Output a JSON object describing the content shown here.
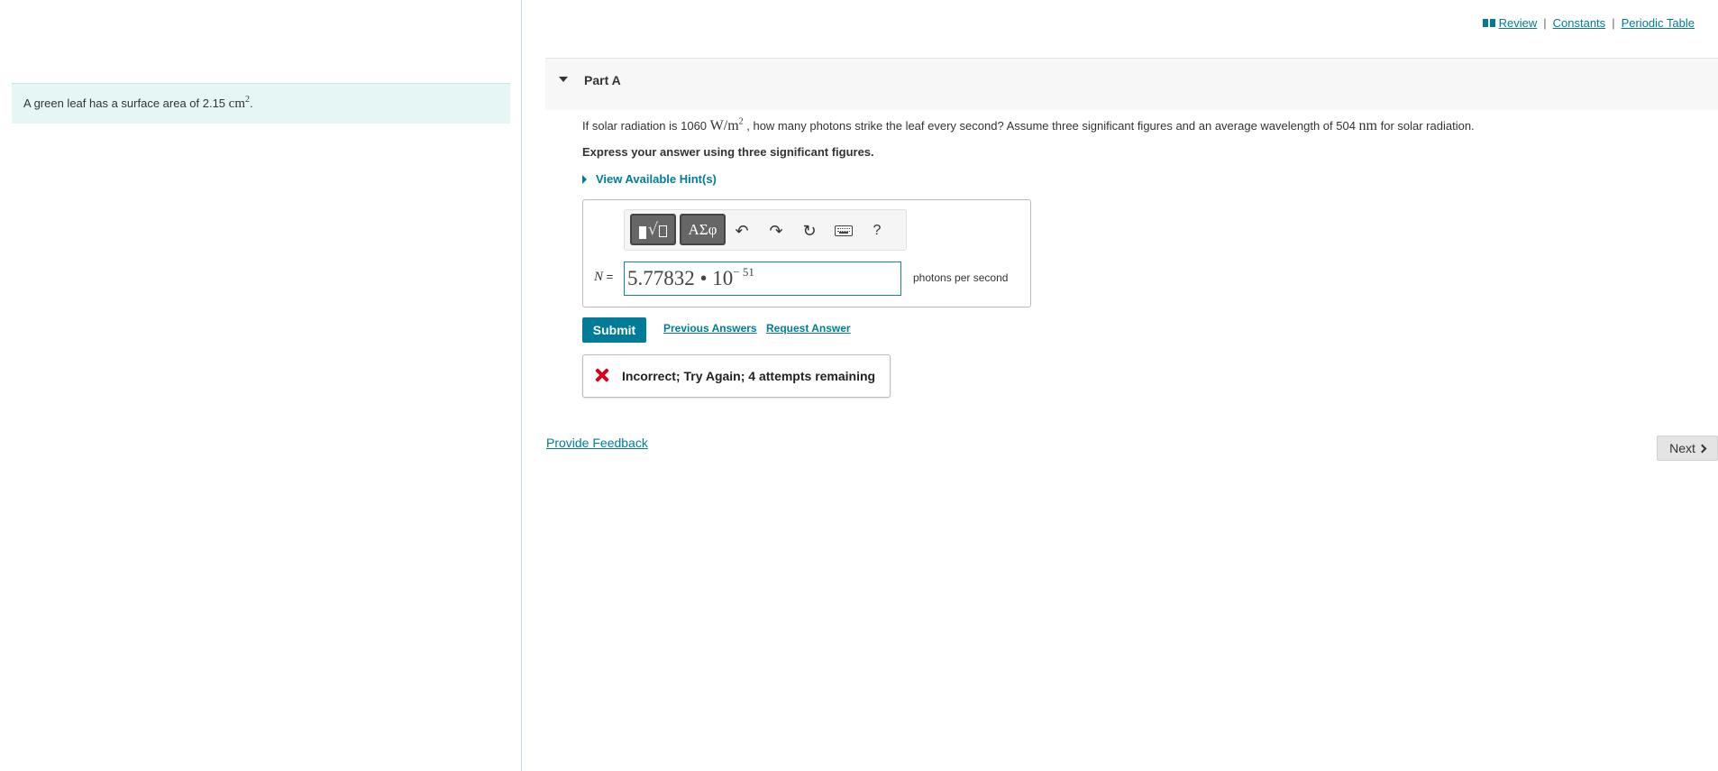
{
  "intro": {
    "text_before": "A green leaf has a surface area of 2.15 ",
    "unit": "cm",
    "unit_exp": "2",
    "text_after": "."
  },
  "top_links": {
    "review": "Review",
    "sep1": "|",
    "constants": "Constants",
    "sep2": "|",
    "periodic_table": "Periodic Table"
  },
  "part": {
    "title": "Part A"
  },
  "question": {
    "text1": "If solar radiation is 1060 ",
    "unit1": "W/m",
    "unit1_exp": "2",
    "text2": " , how many photons strike the leaf every second? Assume three significant figures and an average wavelength of 504 ",
    "unit2": "nm",
    "text3": " for solar radiation."
  },
  "instruction": "Express your answer using three significant figures.",
  "hint_toggle": "View Available Hint(s)",
  "toolbar": {
    "greek_label": "ΑΣφ",
    "undo_glyph": "↶",
    "redo_glyph": "↷",
    "reset_glyph": "↻",
    "help_label": "?"
  },
  "answer": {
    "variable": "N",
    "equals": " =",
    "mantissa": "5.77832 • 10",
    "exponent": "− 51",
    "units": "photons per second"
  },
  "actions": {
    "submit": "Submit",
    "previous_answers": "Previous Answers",
    "request_answer": "Request Answer"
  },
  "feedback": {
    "message": "Incorrect; Try Again; 4 attempts remaining"
  },
  "footer": {
    "provide_feedback": "Provide Feedback",
    "next": "Next"
  },
  "colors": {
    "accent": "#007c99",
    "intro_bg": "#e6f6f5",
    "error": "#d6001c"
  }
}
